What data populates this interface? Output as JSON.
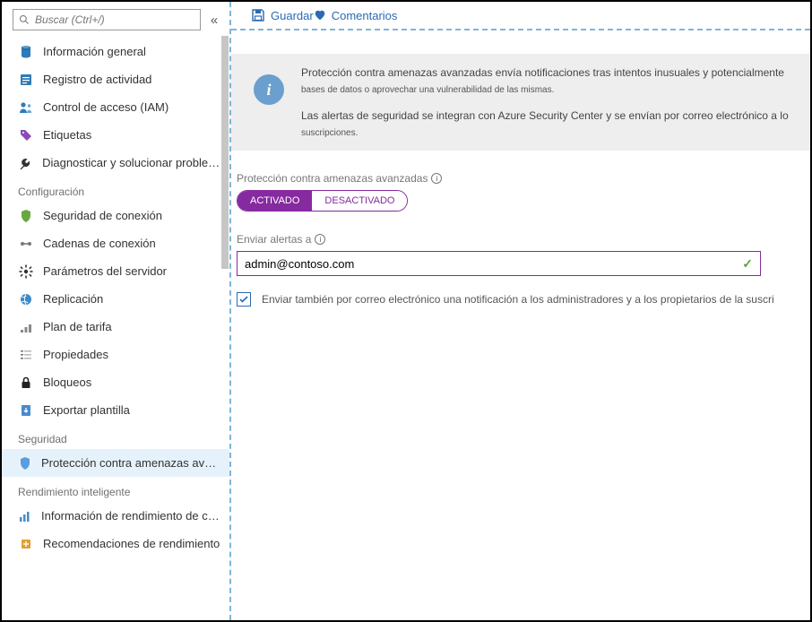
{
  "search": {
    "placeholder": "Buscar (Ctrl+/)"
  },
  "toolbar": {
    "save_label": "Guardar",
    "comments_label": "Comentarios"
  },
  "sidebar": {
    "items_top": [
      {
        "key": "overview",
        "label": "Información general"
      },
      {
        "key": "activity",
        "label": "Registro de actividad"
      },
      {
        "key": "iam",
        "label": "Control de acceso (IAM)"
      },
      {
        "key": "tags",
        "label": "Etiquetas"
      },
      {
        "key": "diagnose",
        "label": "Diagnosticar y solucionar problemas"
      }
    ],
    "section_config": "Configuración",
    "items_config": [
      {
        "key": "connsec",
        "label": "Seguridad de conexión"
      },
      {
        "key": "connstr",
        "label": "Cadenas de conexión"
      },
      {
        "key": "params",
        "label": "Parámetros del servidor"
      },
      {
        "key": "repl",
        "label": "Replicación"
      },
      {
        "key": "pricing",
        "label": "Plan de tarifa"
      },
      {
        "key": "props",
        "label": "Propiedades"
      },
      {
        "key": "locks",
        "label": "Bloqueos"
      },
      {
        "key": "export",
        "label": "Exportar plantilla"
      }
    ],
    "section_security": "Seguridad",
    "items_security": [
      {
        "key": "atp",
        "label": "Protección contra amenazas avanzadas ...",
        "selected": true
      }
    ],
    "section_perf": "Rendimiento inteligente",
    "items_perf": [
      {
        "key": "qpi",
        "label": "Información de rendimiento de consultas"
      },
      {
        "key": "perfrec",
        "label": "Recomendaciones de rendimiento"
      }
    ]
  },
  "banner": {
    "p1": "Protección contra amenazas avanzadas envía notificaciones tras intentos inusuales y potencialmente",
    "p1b": "bases de datos o aprovechar una vulnerabilidad de las mismas.",
    "p2": "Las alertas de seguridad se integran con Azure Security Center y se envían por correo electrónico a lo",
    "p2b": "suscripciones."
  },
  "atp_toggle": {
    "label": "Protección contra amenazas avanzadas",
    "on": "ACTIVADO",
    "off": "DESACTIVADO",
    "state": "on"
  },
  "alerts": {
    "label": "Enviar alertas a",
    "value": "admin@contoso.com"
  },
  "also_email": {
    "checked": true,
    "label": "Enviar también por correo electrónico una notificación a los administradores y a los propietarios de la suscri"
  }
}
